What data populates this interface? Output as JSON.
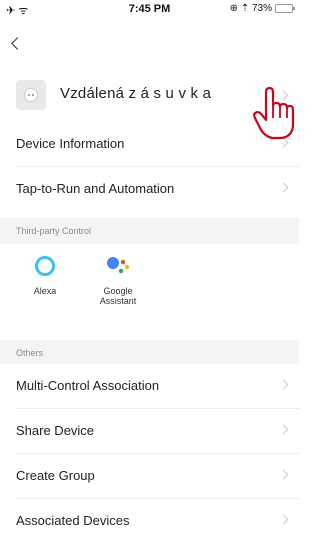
{
  "status_bar": {
    "time": "7:45 PM",
    "left_icons": "✈ ᯤ",
    "right_text": "⊕ ⇡ 73%",
    "battery_percent": 73
  },
  "device": {
    "name": "Vzdálená z á s u v k a"
  },
  "rows_top": [
    {
      "label": "Device Information"
    },
    {
      "label": "Tap-to-Run and Automation"
    }
  ],
  "section_third_party": "Third-party Control",
  "services": [
    {
      "name": "Alexa",
      "icon": "alexa-icon"
    },
    {
      "name": "Google Assistant",
      "icon": "google-assistant-icon"
    }
  ],
  "section_others": "Others",
  "rows_others": [
    {
      "label": "Multi-Control Association"
    },
    {
      "label": "Share Device"
    },
    {
      "label": "Create Group"
    },
    {
      "label": "Associated Devices"
    }
  ]
}
